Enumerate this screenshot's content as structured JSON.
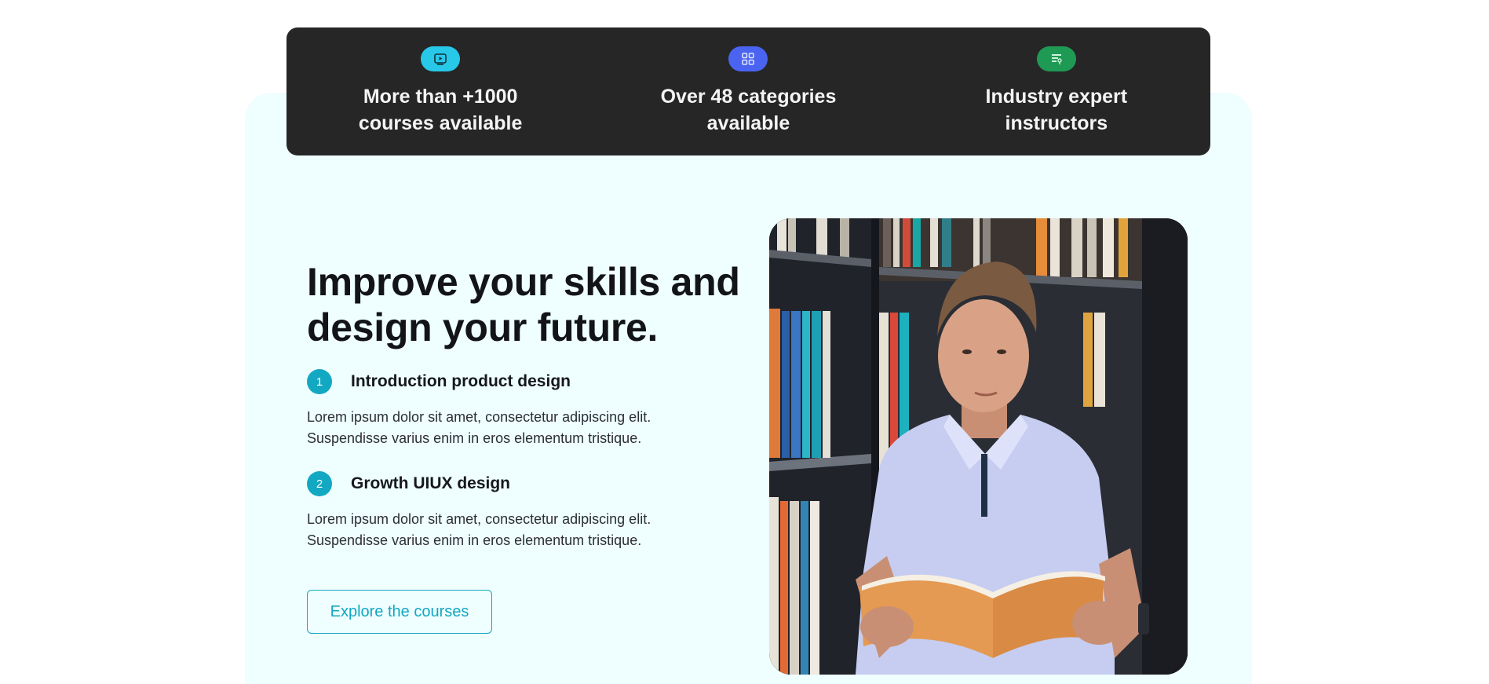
{
  "colors": {
    "accent": "#12a8c2",
    "panel_bg": "#effefe",
    "bar_bg": "#262626",
    "icon_video_bg": "#27c8e8",
    "icon_grid_bg": "#4a63f0",
    "icon_expert_bg": "#1f9a55"
  },
  "stats": [
    {
      "icon": "play-video-icon",
      "label": "More than +1000\ncourses available"
    },
    {
      "icon": "grid-categories-icon",
      "label": "Over 48 categories\navailable"
    },
    {
      "icon": "instructor-icon",
      "label": "Industry expert\ninstructors"
    }
  ],
  "hero": {
    "headline": "Improve your skills and\ndesign your future.",
    "steps": [
      {
        "number": "1",
        "title": "Introduction product design",
        "text": "Lorem ipsum dolor sit amet, consectetur adipiscing elit.\nSuspendisse varius enim in eros elementum tristique."
      },
      {
        "number": "2",
        "title": "Growth UIUX design",
        "text": "Lorem ipsum dolor sit amet, consectetur adipiscing elit.\nSuspendisse varius enim in eros elementum tristique."
      }
    ],
    "cta_label": "Explore the courses"
  },
  "image": {
    "subject": "student-holding-open-book-in-library-photo"
  }
}
